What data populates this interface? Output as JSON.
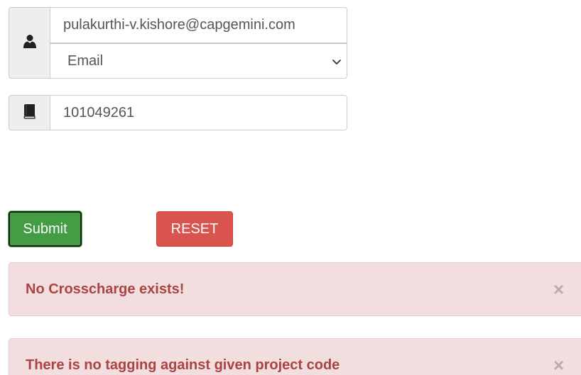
{
  "form": {
    "email_value": "pulakurthi-v.kishore@capgemini.com",
    "id_type_selected": "Email",
    "project_code_value": "101049261"
  },
  "icons": {
    "user": "user-icon",
    "book": "book-icon",
    "chevron": "chevron-down-icon",
    "close": "close-icon"
  },
  "buttons": {
    "submit_label": "Submit",
    "reset_label": "RESET"
  },
  "alerts": [
    {
      "message": "No Crosscharge exists!",
      "close_label": "×"
    },
    {
      "message": "There is no tagging against given project code",
      "close_label": "×"
    }
  ],
  "colors": {
    "submit": "#449d44",
    "reset": "#d9534f",
    "alert_bg": "#f2dede",
    "alert_text": "#a94442"
  }
}
